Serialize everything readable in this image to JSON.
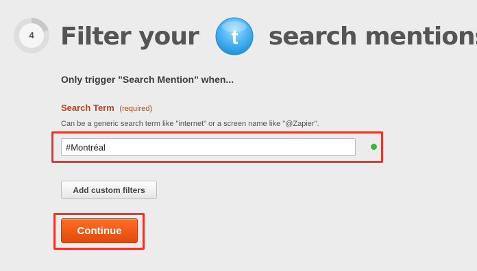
{
  "step": {
    "number": "4"
  },
  "heading": {
    "prefix": "Filter your",
    "service_icon": "twitter-bird-icon",
    "suffix": "search mentions"
  },
  "intro": "Only trigger \"Search Mention\" when...",
  "search_term": {
    "label": "Search Term",
    "required": "(required)",
    "help": "Can be a generic search term like \"internet\" or a screen name like \"@Zapier\".",
    "value": "#Montréal",
    "status_color": "#3cb43c"
  },
  "buttons": {
    "add_filters": "Add custom filters",
    "continue": "Continue"
  },
  "colors": {
    "accent": "#f05a1a",
    "label": "#c1411d",
    "highlight": "#e8372a",
    "twitter": "#4ab3f4"
  }
}
